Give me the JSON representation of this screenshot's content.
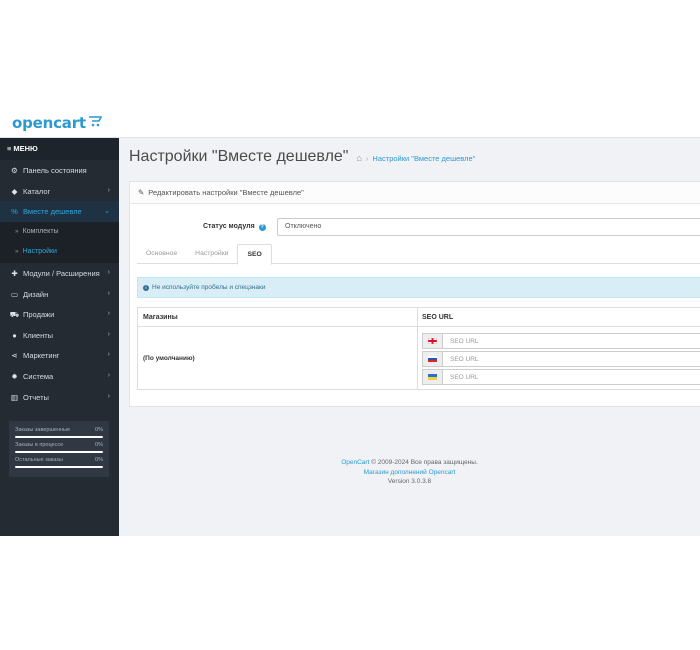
{
  "brand": {
    "logo_text": "opencart"
  },
  "sidebar": {
    "menu_label": "МЕНЮ",
    "items": [
      {
        "label": "Панель состояния",
        "icon": "dashboard-icon",
        "glyph": "⚙",
        "has_arrow": false
      },
      {
        "label": "Каталог",
        "icon": "tag-icon",
        "glyph": "🏷",
        "has_arrow": true
      },
      {
        "label": "Вместе дешевле",
        "icon": "percent-icon",
        "glyph": "%",
        "has_arrow": true,
        "active": true
      },
      {
        "label": "Модули / Расширения",
        "icon": "puzzle-icon",
        "glyph": "✚",
        "has_arrow": true
      },
      {
        "label": "Дизайн",
        "icon": "monitor-icon",
        "glyph": "▭",
        "has_arrow": true
      },
      {
        "label": "Продажи",
        "icon": "cart-icon",
        "glyph": "⛟",
        "has_arrow": true
      },
      {
        "label": "Клиенты",
        "icon": "user-icon",
        "glyph": "👤",
        "has_arrow": true
      },
      {
        "label": "Маркетинг",
        "icon": "share-icon",
        "glyph": "⋖",
        "has_arrow": true
      },
      {
        "label": "Система",
        "icon": "cog-icon",
        "glyph": "⚙",
        "has_arrow": true
      },
      {
        "label": "Отчеты",
        "icon": "bar-chart-icon",
        "glyph": "▥",
        "has_arrow": true
      }
    ],
    "subitems": [
      {
        "label": "Комплекты"
      },
      {
        "label": "Настройки"
      }
    ],
    "stats": [
      {
        "label": "Заказы завершенные",
        "value": "0%"
      },
      {
        "label": "Заказы в процессе",
        "value": "0%"
      },
      {
        "label": "Остальные заказы",
        "value": "0%"
      }
    ]
  },
  "page": {
    "title": "Настройки \"Вместе дешевле\"",
    "breadcrumb": "Настройки \"Вместе дешевле\""
  },
  "panel": {
    "heading": "Редактировать настройки \"Вместе дешевле\"",
    "status_label": "Статус модуля",
    "status_value": "Отключено",
    "tabs": [
      "Основное",
      "Настройки",
      "SEO"
    ],
    "active_tab": "SEO",
    "alert": "Не используйте пробелы и спецзнаки",
    "table": {
      "col_store": "Магазины",
      "col_seo": "SEO URL",
      "store_name": "(По умолчанию)",
      "placeholders": [
        "SEO URL",
        "SEO URL",
        "SEO URL"
      ]
    }
  },
  "footer": {
    "brand_link": "OpenCart",
    "copyright": "© 2009-2024 Все права защищены.",
    "addons_link": "Магазин дополнений Opencart",
    "version": "Version 3.0.3.8"
  },
  "colors": {
    "accent": "#2b9ad1",
    "sidebar_bg": "#242b33",
    "alert_bg": "#d9edf7"
  }
}
